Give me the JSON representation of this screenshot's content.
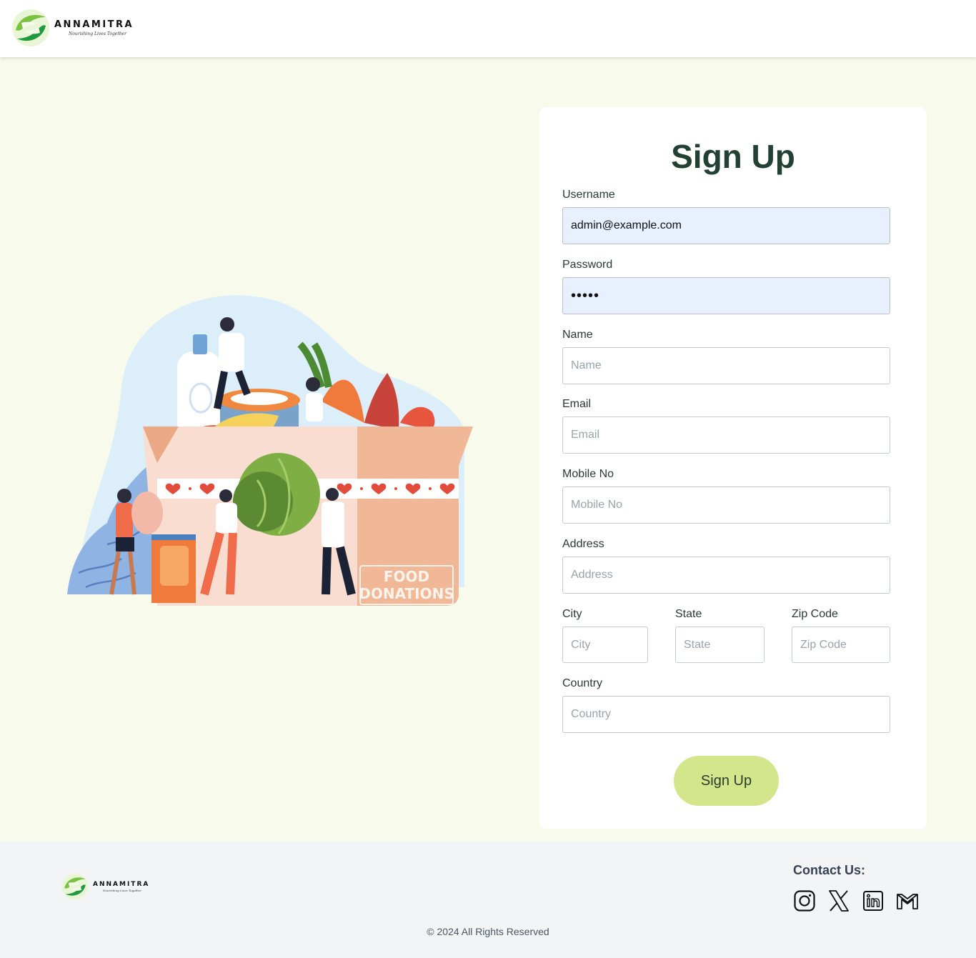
{
  "header": {
    "brand_name": "ANNAMITRA",
    "tagline": "Nourishing Lives Together"
  },
  "illustration": {
    "box_text_line1": "FOOD",
    "box_text_line2": "DONATIONS"
  },
  "form": {
    "title": "Sign Up",
    "username": {
      "label": "Username",
      "value": "admin@example.com"
    },
    "password": {
      "label": "Password",
      "value": "•••••"
    },
    "name": {
      "label": "Name",
      "placeholder": "Name"
    },
    "email": {
      "label": "Email",
      "placeholder": "Email"
    },
    "mobile": {
      "label": "Mobile No",
      "placeholder": "Mobile No"
    },
    "address": {
      "label": "Address",
      "placeholder": "Address"
    },
    "city": {
      "label": "City",
      "placeholder": "City"
    },
    "state": {
      "label": "State",
      "placeholder": "State"
    },
    "zip": {
      "label": "Zip Code",
      "placeholder": "Zip Code"
    },
    "country": {
      "label": "Country",
      "placeholder": "Country"
    },
    "submit_label": "Sign Up"
  },
  "footer": {
    "brand_name": "ANNAMITRA",
    "tagline": "Nourishing Lives Together",
    "contact_title": "Contact Us:",
    "social_icons": [
      "instagram-icon",
      "x-icon",
      "linkedin-icon",
      "gmail-icon"
    ],
    "copyright": "© 2024 All Rights Reserved"
  },
  "colors": {
    "page_bg": "#f8faec",
    "title": "#234035",
    "button_bg": "#d4e68c",
    "autofill_bg": "#e8f0fe",
    "footer_bg": "#f3f4f6"
  }
}
